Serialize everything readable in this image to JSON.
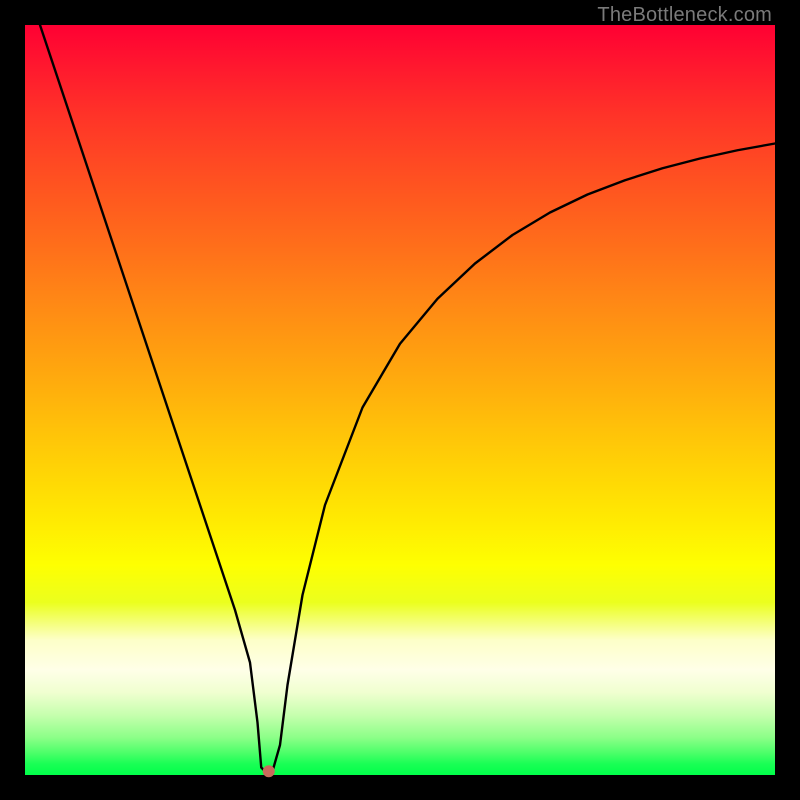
{
  "watermark": "TheBottleneck.com",
  "chart_data": {
    "type": "line",
    "title": "",
    "xlabel": "",
    "ylabel": "",
    "xlim": [
      0,
      100
    ],
    "ylim": [
      0,
      100
    ],
    "grid": false,
    "legend": false,
    "background_gradient": {
      "top": "#ff0033",
      "bottom": "#00ff4a"
    },
    "series": [
      {
        "name": "curve",
        "color": "#000000",
        "x": [
          2,
          5,
          10,
          15,
          20,
          25,
          28,
          30,
          31,
          31.5,
          32,
          33,
          34,
          35,
          37,
          40,
          45,
          50,
          55,
          60,
          65,
          70,
          75,
          80,
          85,
          90,
          95,
          100
        ],
        "values": [
          100,
          91,
          76,
          61,
          46,
          31,
          22,
          15,
          7,
          1,
          0.5,
          0.5,
          4,
          12,
          24,
          36,
          49,
          57.5,
          63.5,
          68.2,
          72,
          75,
          77.4,
          79.3,
          80.9,
          82.2,
          83.3,
          84.2
        ]
      }
    ],
    "marker": {
      "x": 32.5,
      "y": 0.5,
      "color": "#c96a5c",
      "radius": 6
    }
  }
}
